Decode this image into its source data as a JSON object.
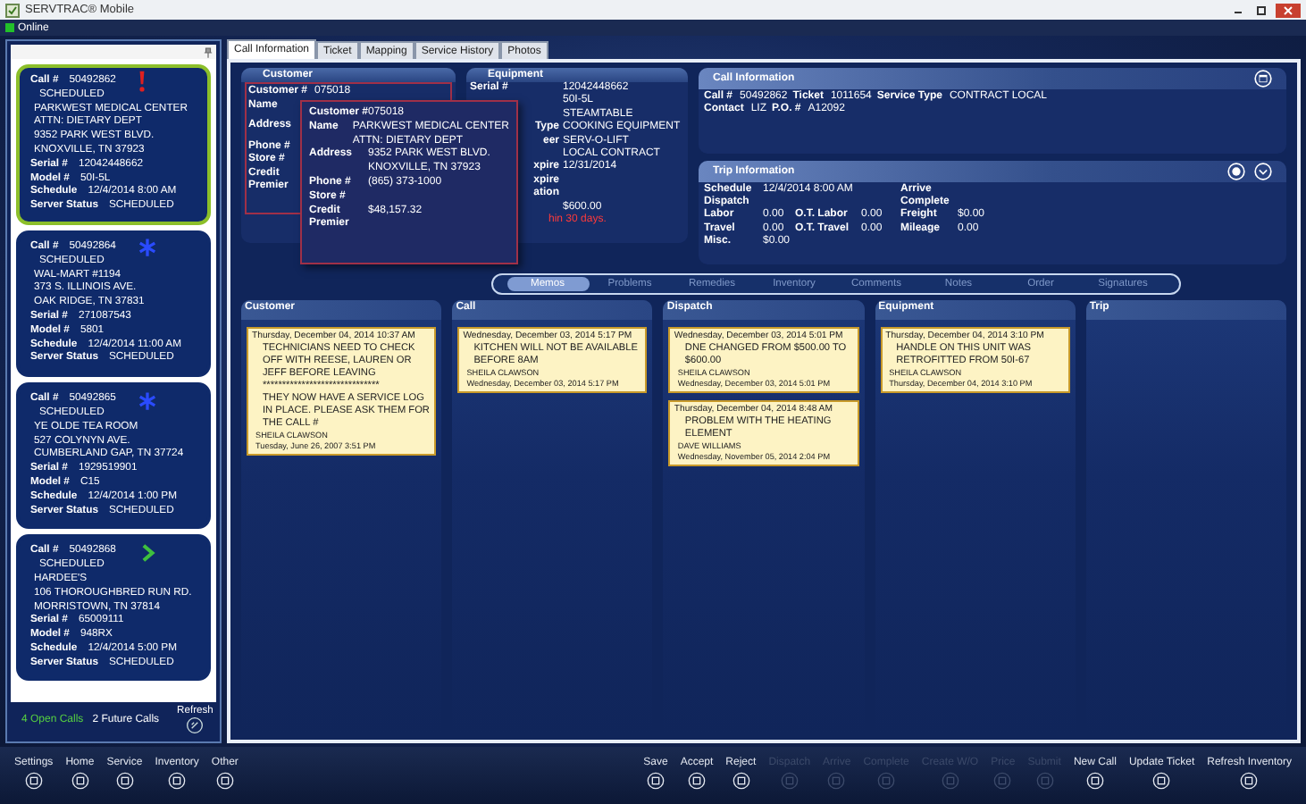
{
  "window": {
    "title": "SERVTRAC® Mobile"
  },
  "connection": {
    "label": "Online",
    "online": true
  },
  "call_list": {
    "cards": [
      {
        "call_label": "Call #",
        "call": "50492862",
        "status": "SCHEDULED",
        "kind": "alert",
        "selected": true,
        "address": [
          "PARKWEST MEDICAL CENTER",
          "ATTN: DIETARY DEPT",
          "9352 PARK WEST BLVD.",
          "KNOXVILLE, TN 37923"
        ],
        "fields": [
          {
            "label": "Serial #",
            "value": "12042448662"
          },
          {
            "label": "Model #",
            "value": "50I-5L"
          },
          {
            "label": "Schedule",
            "value": "12/4/2014 8:00 AM"
          },
          {
            "label": "Server Status",
            "value": "SCHEDULED"
          }
        ]
      },
      {
        "call_label": "Call #",
        "call": "50492864",
        "status": "SCHEDULED",
        "kind": "star",
        "selected": false,
        "address": [
          "WAL-MART #1194",
          "373 S. ILLINOIS AVE.",
          "OAK RIDGE, TN 37831"
        ],
        "fields": [
          {
            "label": "Serial #",
            "value": "271087543"
          },
          {
            "label": "Model #",
            "value": "5801"
          },
          {
            "label": "Schedule",
            "value": "12/4/2014 11:00 AM"
          },
          {
            "label": "Server Status",
            "value": "SCHEDULED"
          }
        ]
      },
      {
        "call_label": "Call #",
        "call": "50492865",
        "status": "SCHEDULED",
        "kind": "star",
        "selected": false,
        "address": [
          "YE OLDE TEA ROOM",
          "527 COLYNYN AVE.",
          "CUMBERLAND GAP, TN 37724"
        ],
        "fields": [
          {
            "label": "Serial #",
            "value": "1929519901"
          },
          {
            "label": "Model #",
            "value": "C15"
          },
          {
            "label": "Schedule",
            "value": "12/4/2014 1:00 PM"
          },
          {
            "label": "Server Status",
            "value": "SCHEDULED"
          }
        ]
      },
      {
        "call_label": "Call #",
        "call": "50492868",
        "status": "SCHEDULED",
        "kind": "chevron",
        "selected": false,
        "address": [
          "HARDEE'S",
          "106 THOROUGHBRED RUN RD.",
          "MORRISTOWN, TN 37814"
        ],
        "fields": [
          {
            "label": "Serial #",
            "value": "65009111"
          },
          {
            "label": "Model #",
            "value": "948RX"
          },
          {
            "label": "Schedule",
            "value": "12/4/2014 5:00 PM"
          },
          {
            "label": "Server Status",
            "value": "SCHEDULED"
          }
        ]
      }
    ],
    "open_calls": "4 Open Calls",
    "future_calls": "2 Future Calls",
    "refresh": "Refresh"
  },
  "tabs": [
    {
      "label": "Call Information",
      "selected": true
    },
    {
      "label": "Ticket",
      "selected": false
    },
    {
      "label": "Mapping",
      "selected": false
    },
    {
      "label": "Service History",
      "selected": false
    },
    {
      "label": "Photos",
      "selected": false
    }
  ],
  "customer": {
    "title": "Customer",
    "rows": [
      {
        "label": "Customer #",
        "value": "075018"
      },
      {
        "label": "Name"
      },
      {
        "label": "Address"
      },
      {
        "label": "Phone #"
      },
      {
        "label": "Store #"
      },
      {
        "label": "Credit"
      },
      {
        "label": "Premier"
      }
    ]
  },
  "customer_popup": {
    "rows": [
      {
        "label": "Customer #",
        "lines": [
          "075018"
        ]
      },
      {
        "label": "Name",
        "lines": [
          "PARKWEST MEDICAL CENTER",
          "ATTN: DIETARY DEPT"
        ]
      },
      {
        "label": "Address",
        "lines": [
          "9352 PARK WEST BLVD.",
          "KNOXVILLE, TN 37923"
        ]
      },
      {
        "label": "Phone #",
        "lines": [
          "(865) 373-1000"
        ]
      },
      {
        "label": "Store #",
        "lines": []
      },
      {
        "label": "Credit",
        "lines": [
          "$48,157.32"
        ]
      },
      {
        "label": "Premier",
        "lines": []
      }
    ]
  },
  "equipment": {
    "title": "Equipment",
    "rows": [
      {
        "label": "Serial #",
        "value": "12042448662"
      },
      {
        "value": "50I-5L"
      },
      {
        "value": "STEAMTABLE"
      },
      {
        "label": "Type",
        "value": "COOKING EQUIPMENT"
      },
      {
        "label": "eer",
        "value": "SERV-O-LIFT"
      },
      {
        "value": "LOCAL CONTRACT"
      },
      {
        "label": "xpire",
        "value": "12/31/2014"
      },
      {
        "label": "xpire"
      },
      {
        "label": "ation"
      },
      {
        "value": "$600.00"
      }
    ],
    "warning": "hin 30 days."
  },
  "call_information": {
    "title": "Call Information",
    "rows": [
      [
        {
          "label": "Call #",
          "value": "50492862"
        },
        {
          "label": "Ticket",
          "value": "1011654"
        },
        {
          "label": "Service Type",
          "value": "CONTRACT LOCAL"
        }
      ],
      [
        {
          "label": "Contact",
          "value": "LIZ"
        },
        {
          "label": "P.O. #",
          "value": "A12092"
        }
      ]
    ]
  },
  "trip_information": {
    "title": "Trip Information",
    "left": [
      [
        {
          "label": "Schedule",
          "value": "12/4/2014 8:00 AM"
        }
      ],
      [
        {
          "label": "Dispatch"
        }
      ],
      [
        {
          "label": "Labor",
          "value": "0.00"
        },
        {
          "label": "O.T. Labor",
          "value": "0.00"
        }
      ],
      [
        {
          "label": "Travel",
          "value": "0.00"
        },
        {
          "label": "O.T. Travel",
          "value": "0.00"
        }
      ],
      [
        {
          "label": "Misc.",
          "value": "$0.00"
        }
      ]
    ],
    "right": [
      {
        "label": "Arrive"
      },
      {
        "label": "Complete"
      },
      {
        "label": "Freight",
        "value": "$0.00"
      },
      {
        "label": "Mileage",
        "value": "0.00"
      }
    ]
  },
  "sections": [
    {
      "label": "Memos",
      "selected": true
    },
    {
      "label": "Problems",
      "selected": false
    },
    {
      "label": "Remedies",
      "selected": false
    },
    {
      "label": "Inventory",
      "selected": false
    },
    {
      "label": "Comments",
      "selected": false
    },
    {
      "label": "Notes",
      "selected": false
    },
    {
      "label": "Order",
      "selected": false
    },
    {
      "label": "Signatures",
      "selected": false
    }
  ],
  "memo_columns": [
    {
      "title": "Customer",
      "notes": [
        {
          "header": "Thursday, December 04, 2014 10:37 AM",
          "lines": [
            "TECHNICIANS NEED TO CHECK OFF WITH REESE, LAUREN OR JEFF BEFORE LEAVING",
            "******************************",
            "THEY NOW HAVE A SERVICE LOG IN PLACE. PLEASE ASK THEM FOR THE CALL #"
          ],
          "author": "SHEILA CLAWSON",
          "footer": "Tuesday, June 26, 2007 3:51 PM"
        }
      ]
    },
    {
      "title": "Call",
      "notes": [
        {
          "header": "Wednesday, December 03, 2014 5:17 PM",
          "lines": [
            "KITCHEN WILL NOT BE AVAILABLE BEFORE 8AM"
          ],
          "author": "SHEILA CLAWSON",
          "footer": "Wednesday, December 03, 2014 5:17 PM"
        }
      ]
    },
    {
      "title": "Dispatch",
      "notes": [
        {
          "header": "Wednesday, December 03, 2014 5:01 PM",
          "lines": [
            "DNE CHANGED FROM $500.00 TO $600.00"
          ],
          "author": "SHEILA CLAWSON",
          "footer": "Wednesday, December 03, 2014 5:01 PM"
        },
        {
          "header": "Thursday, December 04, 2014 8:48 AM",
          "lines": [
            "PROBLEM WITH THE HEATING ELEMENT"
          ],
          "author": "DAVE WILLIAMS",
          "footer": "Wednesday, November 05, 2014 2:04 PM"
        }
      ]
    },
    {
      "title": "Equipment",
      "notes": [
        {
          "header": "Thursday, December 04, 2014 3:10 PM",
          "lines": [
            "HANDLE ON THIS UNIT WAS RETROFITTED FROM 50I-67"
          ],
          "author": "SHEILA CLAWSON",
          "footer": "Thursday, December 04, 2014 3:10 PM"
        }
      ]
    },
    {
      "title": "Trip"
    }
  ],
  "toolbar": {
    "left": [
      {
        "label": "Settings",
        "disabled": false
      },
      {
        "label": "Home",
        "disabled": false
      },
      {
        "label": "Service",
        "disabled": false
      },
      {
        "label": "Inventory",
        "disabled": false
      },
      {
        "label": "Other",
        "disabled": false
      }
    ],
    "right": [
      {
        "label": "Save",
        "disabled": false
      },
      {
        "label": "Accept",
        "disabled": false
      },
      {
        "label": "Reject",
        "disabled": false
      },
      {
        "label": "Dispatch",
        "disabled": true
      },
      {
        "label": "Arrive",
        "disabled": true
      },
      {
        "label": "Complete",
        "disabled": true
      },
      {
        "label": "Create W/O",
        "disabled": true
      },
      {
        "label": "Price",
        "disabled": true
      },
      {
        "label": "Submit",
        "disabled": true
      },
      {
        "label": "New Call",
        "disabled": false
      },
      {
        "label": "Update Ticket",
        "disabled": false
      },
      {
        "label": "Refresh Inventory",
        "disabled": false
      }
    ]
  }
}
